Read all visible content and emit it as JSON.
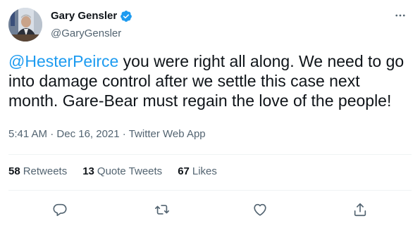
{
  "user": {
    "display_name": "Gary Gensler",
    "handle": "@GaryGensler",
    "verified": true
  },
  "tweet": {
    "mention": "@HesterPeirce",
    "body": " you were right all along. We need to go into damage control after we settle this case next month. Gare-Bear must regain the love of the people!"
  },
  "meta": {
    "time": "5:41 AM",
    "separator1": " · ",
    "date": "Dec 16, 2021",
    "separator2": " · ",
    "source": "Twitter Web App"
  },
  "stats": {
    "retweets_count": "58",
    "retweets_label": "Retweets",
    "quotes_count": "13",
    "quotes_label": "Quote Tweets",
    "likes_count": "67",
    "likes_label": "Likes"
  },
  "icons": {
    "more": "more-icon",
    "verified": "verified-badge-icon",
    "reply": "reply-icon",
    "retweet": "retweet-icon",
    "like": "like-icon",
    "share": "share-icon"
  },
  "colors": {
    "accent": "#1d9bf0",
    "text": "#0f1419",
    "secondary": "#536471",
    "divider": "#eff3f4"
  }
}
